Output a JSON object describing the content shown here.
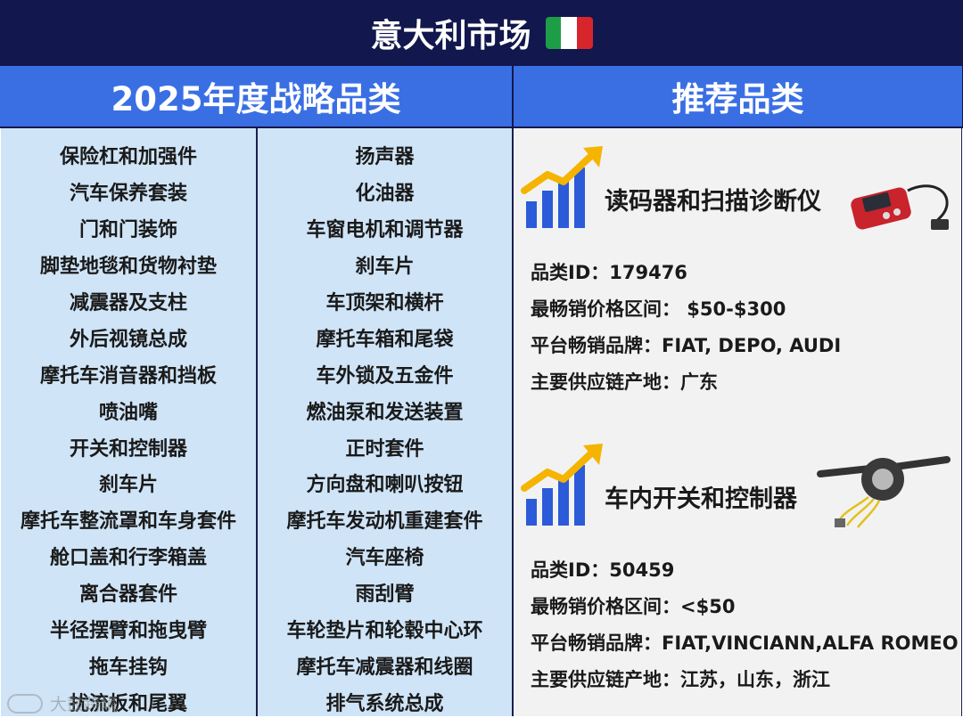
{
  "header": {
    "title": "意大利市场",
    "flag_colors": [
      "#1e9d48",
      "#ffffff",
      "#d7262b"
    ]
  },
  "table": {
    "left_header": "2025年度战略品类",
    "right_header": "推荐品类",
    "column_a": [
      "保险杠和加强件",
      "汽车保养套装",
      "门和门装饰",
      "脚垫地毯和货物衬垫",
      "减震器及支柱",
      "外后视镜总成",
      "摩托车消音器和挡板",
      "喷油嘴",
      "开关和控制器",
      "刹车片",
      "摩托车整流罩和车身套件",
      "舱口盖和行李箱盖",
      "离合器套件",
      "半径摆臂和拖曳臂",
      "拖车挂钩",
      "扰流板和尾翼"
    ],
    "column_b": [
      "扬声器",
      "化油器",
      "车窗电机和调节器",
      "刹车片",
      "车顶架和横杆",
      "摩托车箱和尾袋",
      "车外锁及五金件",
      "燃油泵和发送装置",
      "正时套件",
      "方向盘和喇叭按钮",
      "摩托车发动机重建套件",
      "汽车座椅",
      "雨刮臂",
      "车轮垫片和轮毂中心环",
      "摩托车减震器和线圈",
      "排气系统总成"
    ]
  },
  "recommended": [
    {
      "name": "读码器和扫描诊断仪",
      "icon": "growth-chart-icon",
      "image": "obd-scanner-icon",
      "lines": [
        "品类ID：179476",
        "最畅销价格区间： $50-$300",
        "平台畅销品牌：FIAT, DEPO, AUDI",
        "主要供应链产地：广东"
      ]
    },
    {
      "name": "车内开关和控制器",
      "icon": "growth-chart-icon",
      "image": "steering-switch-icon",
      "lines": [
        "品类ID：50459",
        "最畅销价格区间：<$50",
        "平台畅销品牌：FIAT,VINCIANN,ALFA ROMEO",
        "主要供应链产地：江苏，山东，浙江"
      ]
    }
  ],
  "watermark": "大鼓跨境",
  "colors": {
    "navy": "#12174d",
    "blue": "#3a6fe4",
    "light_blue": "#cfe4f7",
    "panel": "#f2f2f3",
    "growth_blue": "#2b5bd8",
    "growth_gold": "#f4b400"
  }
}
